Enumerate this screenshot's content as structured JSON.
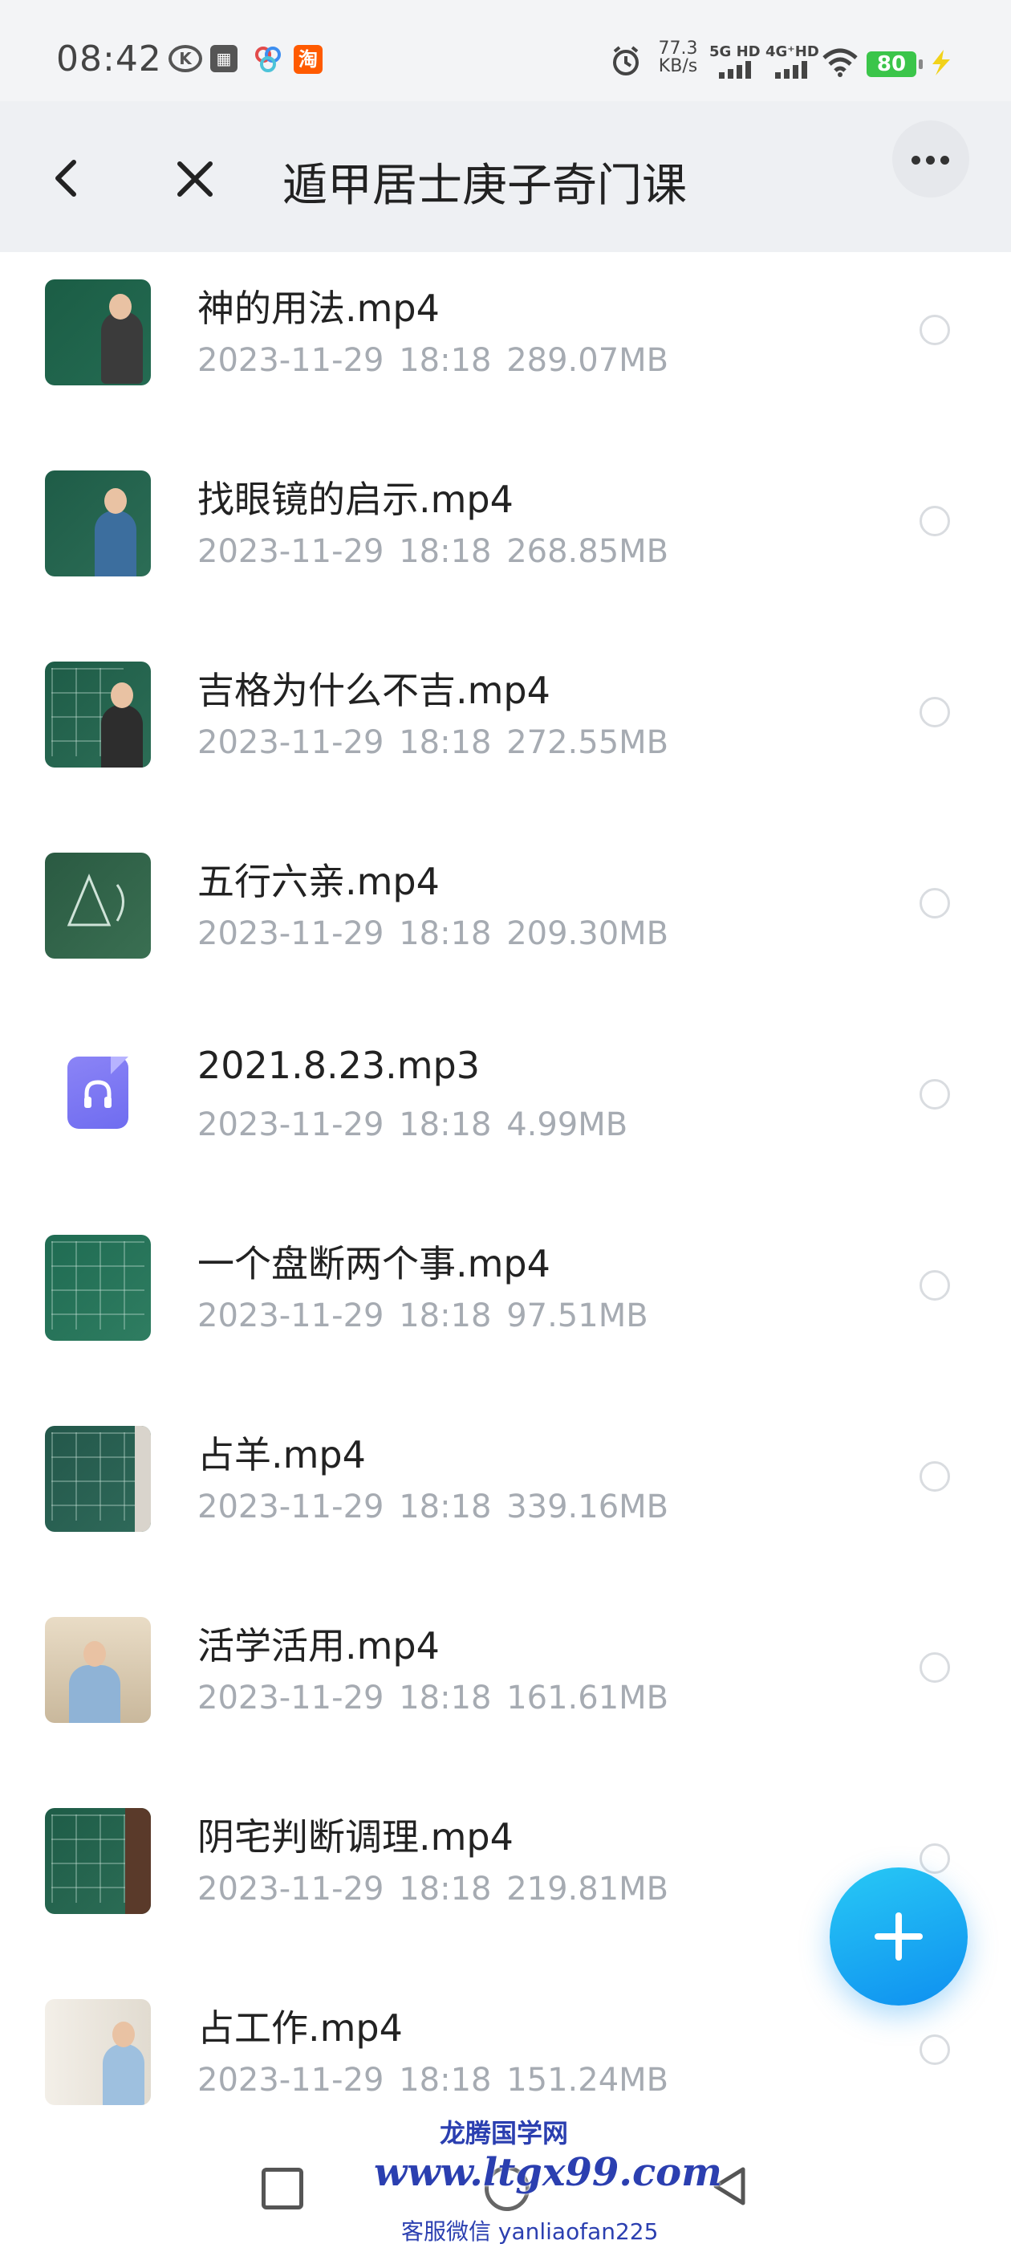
{
  "status_bar": {
    "time": "08:42",
    "speed_value": "77.3",
    "speed_unit": "KB/s",
    "net1": "5G HD",
    "net2": "4G⁺HD",
    "battery": "80"
  },
  "header": {
    "title": "遁甲居士庚子奇门课"
  },
  "files": [
    {
      "name": "神的用法.mp4",
      "date": "2023-11-29",
      "time": "18:18",
      "size": "289.07MB",
      "type": "video"
    },
    {
      "name": "找眼镜的启示.mp4",
      "date": "2023-11-29",
      "time": "18:18",
      "size": "268.85MB",
      "type": "video"
    },
    {
      "name": "吉格为什么不吉.mp4",
      "date": "2023-11-29",
      "time": "18:18",
      "size": "272.55MB",
      "type": "video"
    },
    {
      "name": "五行六亲.mp4",
      "date": "2023-11-29",
      "time": "18:18",
      "size": "209.30MB",
      "type": "video"
    },
    {
      "name": "2021.8.23.mp3",
      "date": "2023-11-29",
      "time": "18:18",
      "size": "4.99MB",
      "type": "audio"
    },
    {
      "name": "一个盘断两个事.mp4",
      "date": "2023-11-29",
      "time": "18:18",
      "size": "97.51MB",
      "type": "video"
    },
    {
      "name": "占羊.mp4",
      "date": "2023-11-29",
      "time": "18:18",
      "size": "339.16MB",
      "type": "video"
    },
    {
      "name": "活学活用.mp4",
      "date": "2023-11-29",
      "time": "18:18",
      "size": "161.61MB",
      "type": "video"
    },
    {
      "name": "阴宅判断调理.mp4",
      "date": "2023-11-29",
      "time": "18:18",
      "size": "219.81MB",
      "type": "video"
    },
    {
      "name": "占工作.mp4",
      "date": "2023-11-29",
      "time": "18:18",
      "size": "151.24MB",
      "type": "video"
    }
  ],
  "watermark": {
    "line1": "龙腾国学网",
    "line2": "www.ltgx99.com",
    "line3": "客服微信 yanliaofan225"
  },
  "colors": {
    "accent": "#1a9df2",
    "meta_text": "#a6abb2",
    "header_bg": "#eef0f3"
  }
}
